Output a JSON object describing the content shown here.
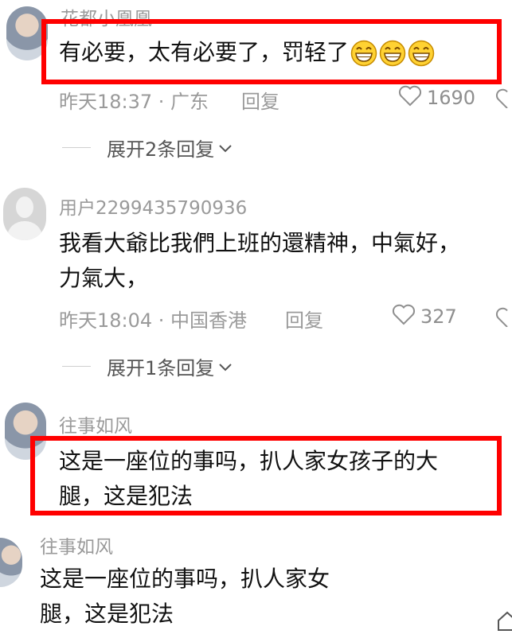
{
  "comments": [
    {
      "username": "花都小凰凰",
      "content": "有必要，太有必要了，罚轻了",
      "emojis": [
        "grin-emoji",
        "grin-emoji",
        "grin-emoji"
      ],
      "time_location": "昨天18:37 · 广东",
      "reply_label": "回复",
      "likes": "1690",
      "expand_label": "展开2条回复"
    },
    {
      "username": "用户2299435790936",
      "content_line1": "我看大爺比我們上班的還精神，中氣好，",
      "content_line2": "力氣大，",
      "time_location": "昨天18:04 · 中国香港",
      "reply_label": "回复",
      "likes": "327",
      "expand_label": "展开1条回复"
    },
    {
      "username": "往事如风",
      "content_line1": "这是一座位的事吗，扒人家女孩子的大",
      "content_line2": "腿，这是犯法"
    },
    {
      "username": "往事如风",
      "content_line1": "这是一座位的事吗，扒人家女",
      "content_line2": "腿，这是犯法"
    }
  ],
  "colors": {
    "highlight_border": "#ff0000",
    "meta_text": "#9a9a9a",
    "body_text": "#111111"
  }
}
